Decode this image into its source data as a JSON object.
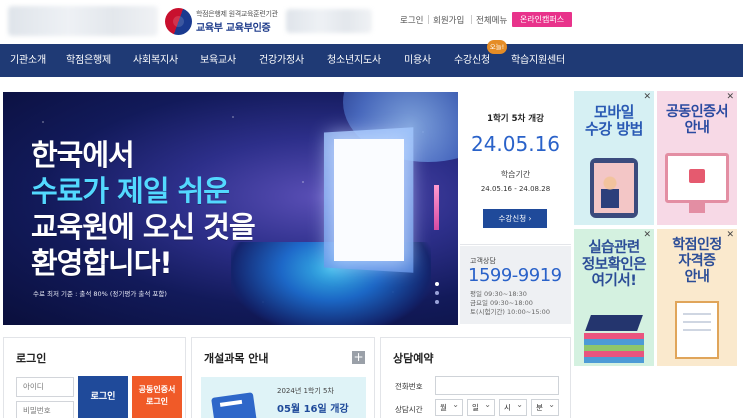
{
  "header": {
    "logo_sub": "학점은행제 원격교육훈련기관",
    "logo_main_prefix": "교육부",
    "logo_main_suffix": "교육부인증",
    "util_links": [
      "로그인",
      "회원가입",
      "전체메뉴"
    ],
    "online_button": "온라인캠퍼스",
    "online_button_color": "#e8338b"
  },
  "nav": {
    "items": [
      "기관소개",
      "학점은행제",
      "사회복지사",
      "보육교사",
      "건강가정사",
      "청소년지도사",
      "미용사",
      "수강신청",
      "학습지원센터"
    ],
    "badge": "오늘!",
    "background": "#1f3a75"
  },
  "hero": {
    "line1": "한국에서",
    "line2": "수료가 제일 쉬운",
    "line3": "교육원에 오신 것을",
    "line4": "환영합니다!",
    "note": "수료 최저 기준 : 출석 80% (정기평가 출석 포함)"
  },
  "schedule": {
    "title": "1학기 5차 개강",
    "date": "24.05.16",
    "period_label": "학습기간",
    "period": "24.05.16 - 24.08.28",
    "button": "수강신청 ›"
  },
  "consult": {
    "label": "고객상담",
    "phone": "1599-9919",
    "hours": [
      "평일 09:30~18:30",
      "금요일 09:30~18:00",
      "토(시험기간) 10:00~15:00"
    ]
  },
  "side_banners": [
    {
      "line1": "모바일",
      "line2": "수강 방법"
    },
    {
      "line1": "공동인증서",
      "line2": "안내"
    },
    {
      "line1": "실습관련",
      "line2": "정보확인은",
      "line3": "여기서!"
    },
    {
      "line1": "학점인정",
      "line2": "자격증",
      "line3": "안내"
    }
  ],
  "login": {
    "title": "로그인",
    "id_placeholder": "아이디",
    "pw_placeholder": "비밀번호",
    "login_button": "로그인",
    "cert_button_line1": "공동인증서",
    "cert_button_line2": "로그인"
  },
  "course": {
    "title": "개설과목 안내",
    "card_sub": "2024년 1학기 5차",
    "card_date": "05월 16일 개강"
  },
  "reserve": {
    "title": "상담예약",
    "phone_label": "전화번호",
    "time_label": "상담시간",
    "selects": [
      "월",
      "일",
      "시",
      "분"
    ]
  },
  "icons": {
    "close": "close-icon",
    "plus": "plus-icon",
    "emblem": "government-emblem-icon"
  }
}
